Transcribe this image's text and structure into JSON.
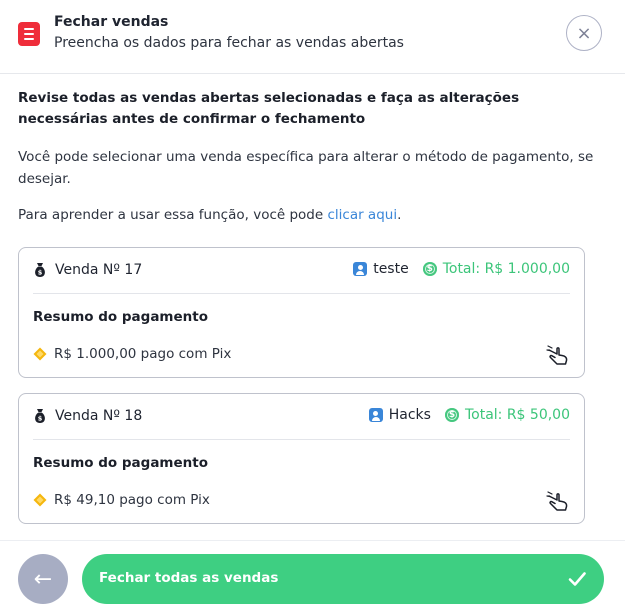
{
  "header": {
    "title": "Fechar vendas",
    "subtitle": "Preencha os dados para fechar as vendas abertas",
    "close_label": "×"
  },
  "intro": {
    "bold": "Revise todas as vendas abertas selecionadas e faça as alterações necessárias antes de confirmar o fechamento",
    "paragraph": "Você pode selecionar uma venda específica para alterar o método de pagamento, se desejar.",
    "learn_prefix": "Para aprender a usar essa função, você pode ",
    "learn_link": "clicar aqui",
    "learn_suffix": "."
  },
  "sales": [
    {
      "label": "Venda Nº 17",
      "client": "teste",
      "total": "Total: R$ 1.000,00",
      "summary_title": "Resumo do pagamento",
      "payment": "R$ 1.000,00 pago com Pix"
    },
    {
      "label": "Venda Nº 18",
      "client": "Hacks",
      "total": "Total: R$ 50,00",
      "summary_title": "Resumo do pagamento",
      "payment": "R$ 49,10 pago com Pix"
    }
  ],
  "footer": {
    "back_label": "←",
    "confirm_label": "Fechar todas as vendas"
  },
  "icons": {
    "header": "receipt-icon",
    "close": "close-icon",
    "sale": "money-bag-icon",
    "client": "user-icon",
    "total": "coin-icon",
    "payment": "pix-icon",
    "select": "hand-pointer-icon",
    "back": "arrow-left-icon",
    "confirm": "check-icon"
  },
  "colors": {
    "accent_green": "#3ecf82",
    "total_green": "#3cc57a",
    "brand_red": "#ef2d3a",
    "link_blue": "#3a86d8",
    "pix_yellow": "#f5b70f",
    "back_gray": "#a7adc3"
  }
}
